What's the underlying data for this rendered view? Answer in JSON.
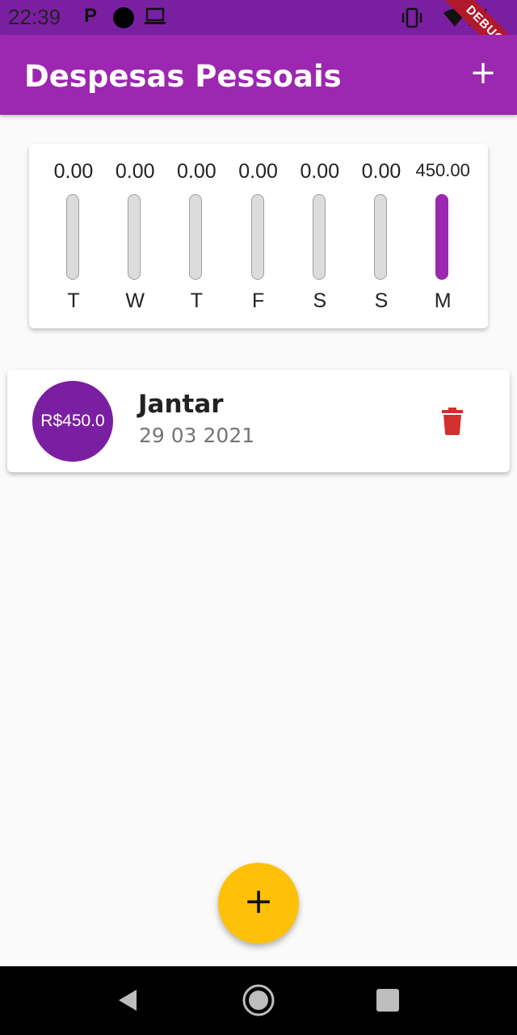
{
  "status_bar": {
    "time": "22:39",
    "p_icon_text": "P",
    "icons": [
      "p-icon",
      "circle-icon",
      "laptop-icon",
      "vibrate-icon",
      "wifi-icon",
      "signal-icon"
    ],
    "debug_label": "DEBUG"
  },
  "app_bar": {
    "title": "Despesas Pessoais",
    "add_icon": "+",
    "background": "#9c27b0"
  },
  "chart": {
    "bars": [
      {
        "amount": "0.00",
        "day": "T",
        "fill": 0
      },
      {
        "amount": "0.00",
        "day": "W",
        "fill": 0
      },
      {
        "amount": "0.00",
        "day": "T",
        "fill": 0
      },
      {
        "amount": "0.00",
        "day": "F",
        "fill": 0
      },
      {
        "amount": "0.00",
        "day": "S",
        "fill": 0
      },
      {
        "amount": "0.00",
        "day": "S",
        "fill": 0
      },
      {
        "amount": "450.00",
        "day": "M",
        "fill": 1
      }
    ]
  },
  "transactions": [
    {
      "avatar_text": "R$450.0",
      "title": "Jantar",
      "date": "29 03 2021",
      "delete_icon": "trash-icon"
    }
  ],
  "fab": {
    "label": "+",
    "color": "#ffc107"
  },
  "colors": {
    "primary": "#9c27b0",
    "avatar": "#7b1fa2",
    "delete": "#d32f2f",
    "accent": "#ffc107"
  }
}
